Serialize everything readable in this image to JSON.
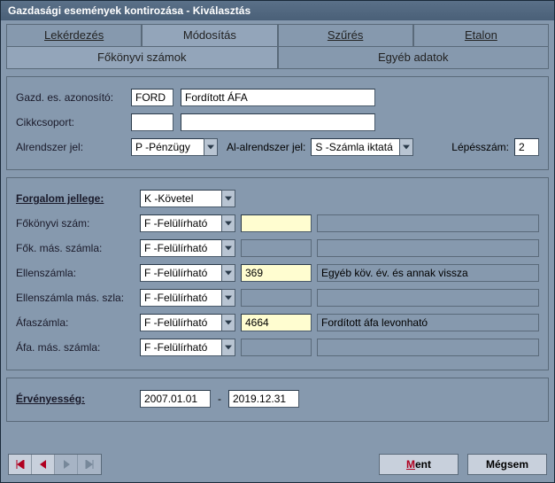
{
  "title": "Gazdasági események kontirozása - Kiválasztás",
  "tabs1": {
    "lekerdez": "Lekérdezés",
    "modositas": "Módosítás",
    "szures": "Szűrés",
    "etalon": "Etalon"
  },
  "tabs2": {
    "fokonyvi": "Főkönyvi számok",
    "egyeb": "Egyéb adatok"
  },
  "labels": {
    "gazd": "Gazd. es. azonosító:",
    "cikkcs": "Cikkcsoport:",
    "alrendszer": "Alrendszer jel:",
    "alalrendszer": "Al-alrendszer jel:",
    "lepesszam": "Lépésszám:",
    "forgalom": "Forgalom jellege:",
    "fokonyviszam": "Főkönyvi szám:",
    "fokmas": "Fők. más. számla:",
    "ellenszamla": "Ellenszámla:",
    "ellenszamlamas": "Ellenszámla más. szla:",
    "afaszamla": "Áfaszámla:",
    "afamas": "Áfa. más. számla:",
    "ervenyesseg": "Érvényesség:"
  },
  "header": {
    "gazd_code": "FORD",
    "gazd_desc": "Fordított ÁFA",
    "cikkcs_code": "",
    "cikkcs_desc": "",
    "alrendszer": "P -Pénzügy",
    "alalrendszer": "S -Számla iktatá",
    "lepesszam": "2"
  },
  "forgalom": "K  -Követel",
  "rows": {
    "fokonyvi": {
      "mode": "F -Felülírható",
      "code": "",
      "desc": ""
    },
    "fokmas": {
      "mode": "F -Felülírható",
      "code": "",
      "desc": ""
    },
    "ellen": {
      "mode": "F -Felülírható",
      "code": "369",
      "desc": "Egyéb köv. év. és annak vissza"
    },
    "ellenmas": {
      "mode": "F -Felülírható",
      "code": "",
      "desc": ""
    },
    "afa": {
      "mode": "F -Felülírható",
      "code": "4664",
      "desc": "Fordított áfa levonható"
    },
    "afamas": {
      "mode": "F -Felülírható",
      "code": "",
      "desc": ""
    }
  },
  "ervenyesseg": {
    "from": "2007.01.01",
    "sep": "-",
    "to": "2019.12.31"
  },
  "buttons": {
    "ment_u": "M",
    "ment_rest": "ent",
    "megsem": "Mégsem"
  }
}
